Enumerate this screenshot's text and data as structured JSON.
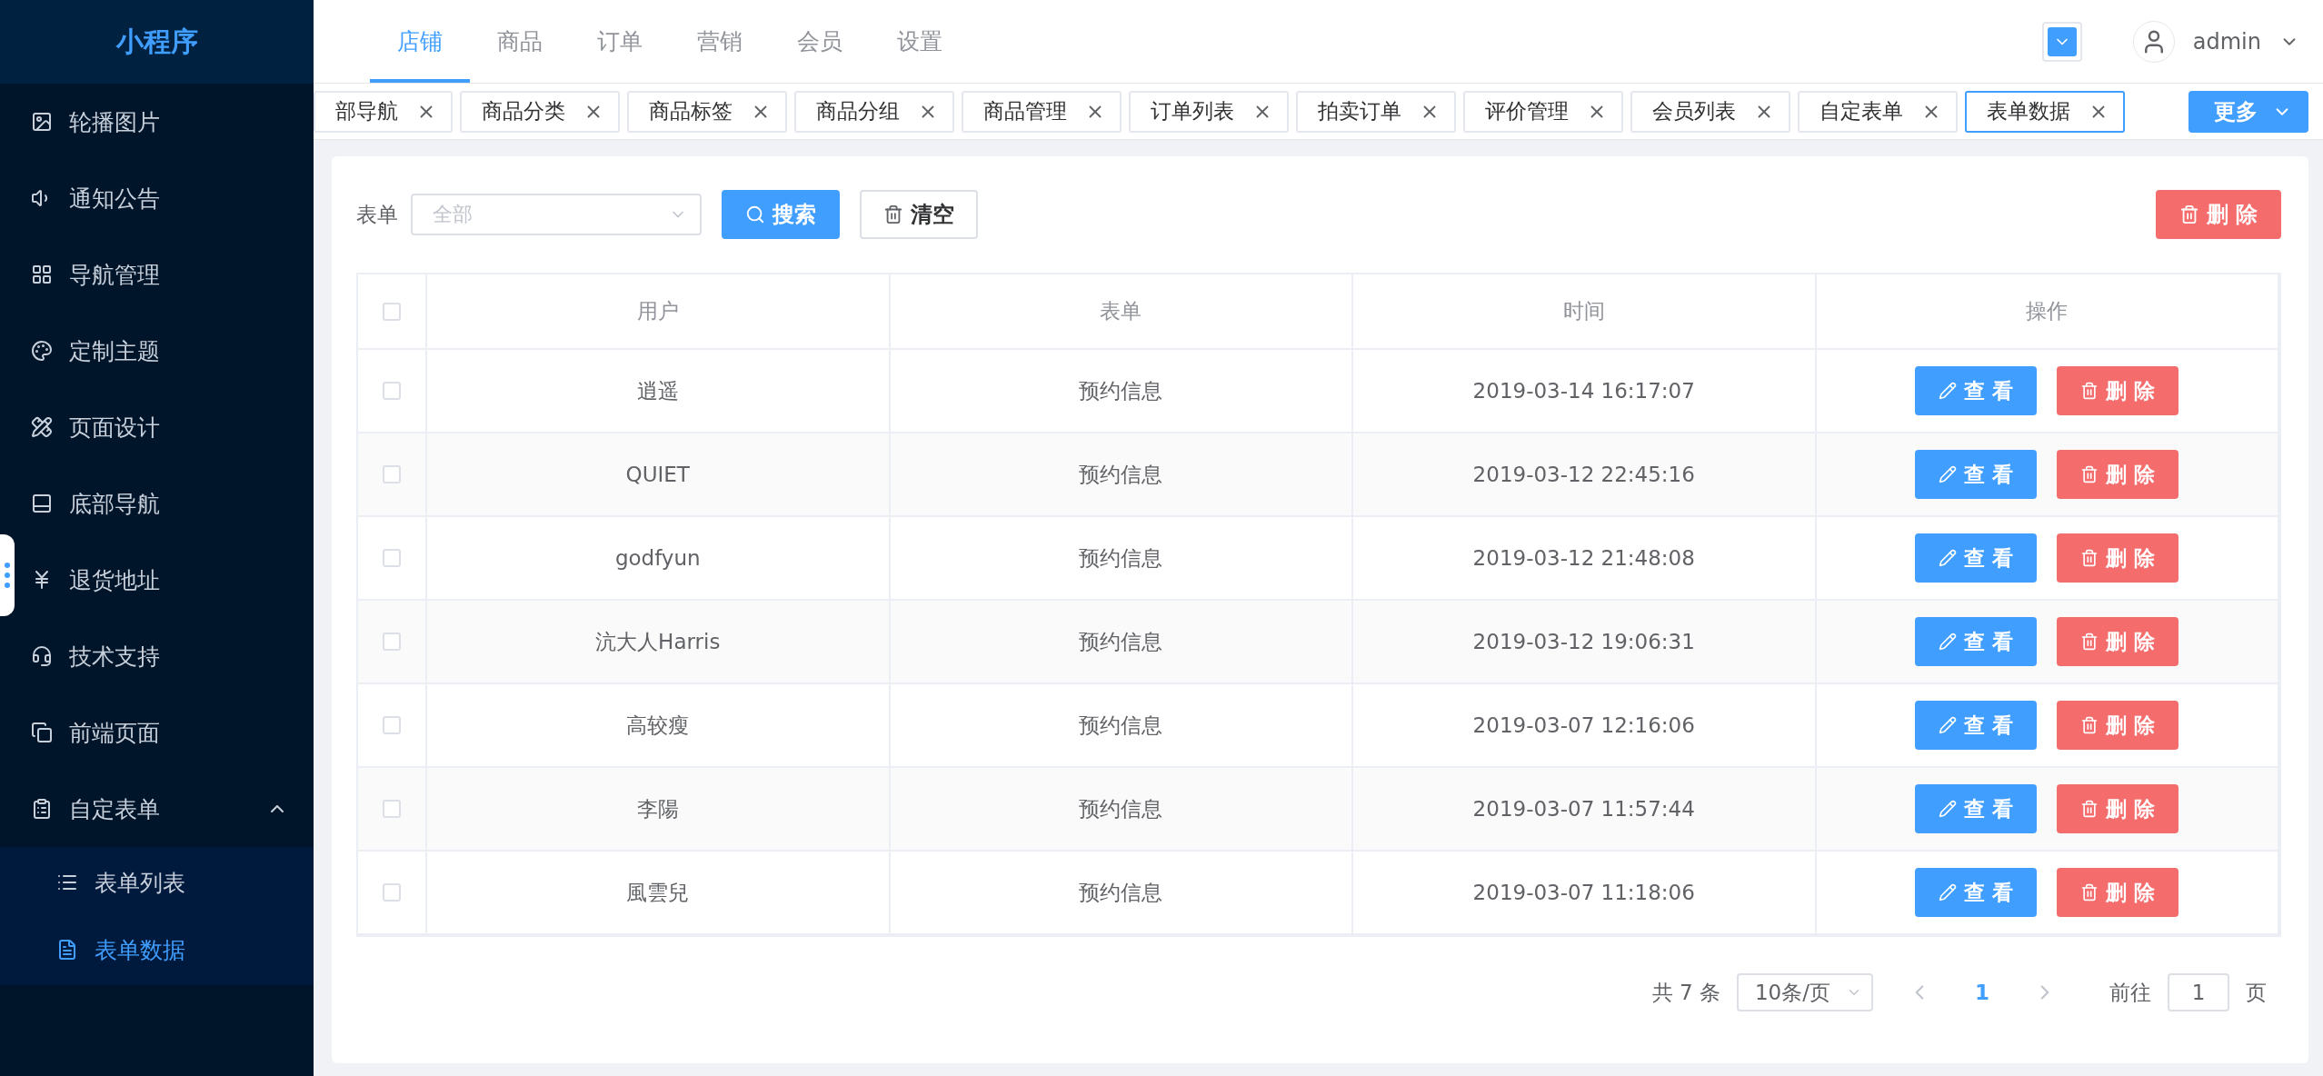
{
  "sidebar": {
    "title": "小程序",
    "items": [
      {
        "label": "轮播图片",
        "selected": false
      },
      {
        "label": "通知公告",
        "selected": false
      },
      {
        "label": "导航管理",
        "selected": false
      },
      {
        "label": "定制主题",
        "selected": false
      },
      {
        "label": "页面设计",
        "selected": false
      },
      {
        "label": "底部导航",
        "selected": false
      },
      {
        "label": "退货地址",
        "selected": false
      },
      {
        "label": "技术支持",
        "selected": false
      },
      {
        "label": "前端页面",
        "selected": false
      },
      {
        "label": "自定表单",
        "selected": false,
        "expanded": true,
        "children": [
          {
            "label": "表单列表",
            "selected": false
          },
          {
            "label": "表单数据",
            "selected": true
          }
        ]
      }
    ]
  },
  "top_nav": {
    "tabs": [
      {
        "label": "店铺",
        "selected": true
      },
      {
        "label": "商品",
        "selected": false
      },
      {
        "label": "订单",
        "selected": false
      },
      {
        "label": "营销",
        "selected": false
      },
      {
        "label": "会员",
        "selected": false
      },
      {
        "label": "设置",
        "selected": false
      }
    ],
    "user": {
      "name": "admin"
    }
  },
  "open_tabs": {
    "items": [
      {
        "label": "部导航",
        "selected": false
      },
      {
        "label": "商品分类",
        "selected": false
      },
      {
        "label": "商品标签",
        "selected": false
      },
      {
        "label": "商品分组",
        "selected": false
      },
      {
        "label": "商品管理",
        "selected": false
      },
      {
        "label": "订单列表",
        "selected": false
      },
      {
        "label": "拍卖订单",
        "selected": false
      },
      {
        "label": "评价管理",
        "selected": false
      },
      {
        "label": "会员列表",
        "selected": false
      },
      {
        "label": "自定表单",
        "selected": false
      },
      {
        "label": "表单数据",
        "selected": true
      }
    ],
    "more_button": "更多"
  },
  "filter": {
    "label": "表单",
    "select": {
      "placeholder": "全部"
    },
    "search_button": "搜索",
    "clear_button": "清空",
    "delete_button": "删 除"
  },
  "table": {
    "header_checked": false,
    "columns": [
      "用户",
      "表单",
      "时间",
      "操作"
    ],
    "rows": [
      {
        "checked": false,
        "user": "逍遥",
        "form": "预约信息",
        "time": "2019-03-14 16:17:07",
        "view_button": "查 看",
        "delete_button": "删 除"
      },
      {
        "checked": false,
        "user": "QUIET",
        "form": "预约信息",
        "time": "2019-03-12 22:45:16",
        "view_button": "查 看",
        "delete_button": "删 除"
      },
      {
        "checked": false,
        "user": "godfyun",
        "form": "预约信息",
        "time": "2019-03-12 21:48:08",
        "view_button": "查 看",
        "delete_button": "删 除"
      },
      {
        "checked": false,
        "user": "沆大人Harris",
        "form": "预约信息",
        "time": "2019-03-12 19:06:31",
        "view_button": "查 看",
        "delete_button": "删 除"
      },
      {
        "checked": false,
        "user": "高较瘦",
        "form": "预约信息",
        "time": "2019-03-07 12:16:06",
        "view_button": "查 看",
        "delete_button": "删 除"
      },
      {
        "checked": false,
        "user": "李陽",
        "form": "预约信息",
        "time": "2019-03-07 11:57:44",
        "view_button": "查 看",
        "delete_button": "删 除"
      },
      {
        "checked": false,
        "user": "風雲兒",
        "form": "预约信息",
        "time": "2019-03-07 11:18:06",
        "view_button": "查 看",
        "delete_button": "删 除"
      }
    ]
  },
  "pagination": {
    "total": "共 7 条",
    "page_size": "10条/页",
    "pages": [
      {
        "label": "1",
        "selected": true
      }
    ],
    "goto_label": "前往",
    "goto_value": "1",
    "goto_suffix": "页"
  }
}
